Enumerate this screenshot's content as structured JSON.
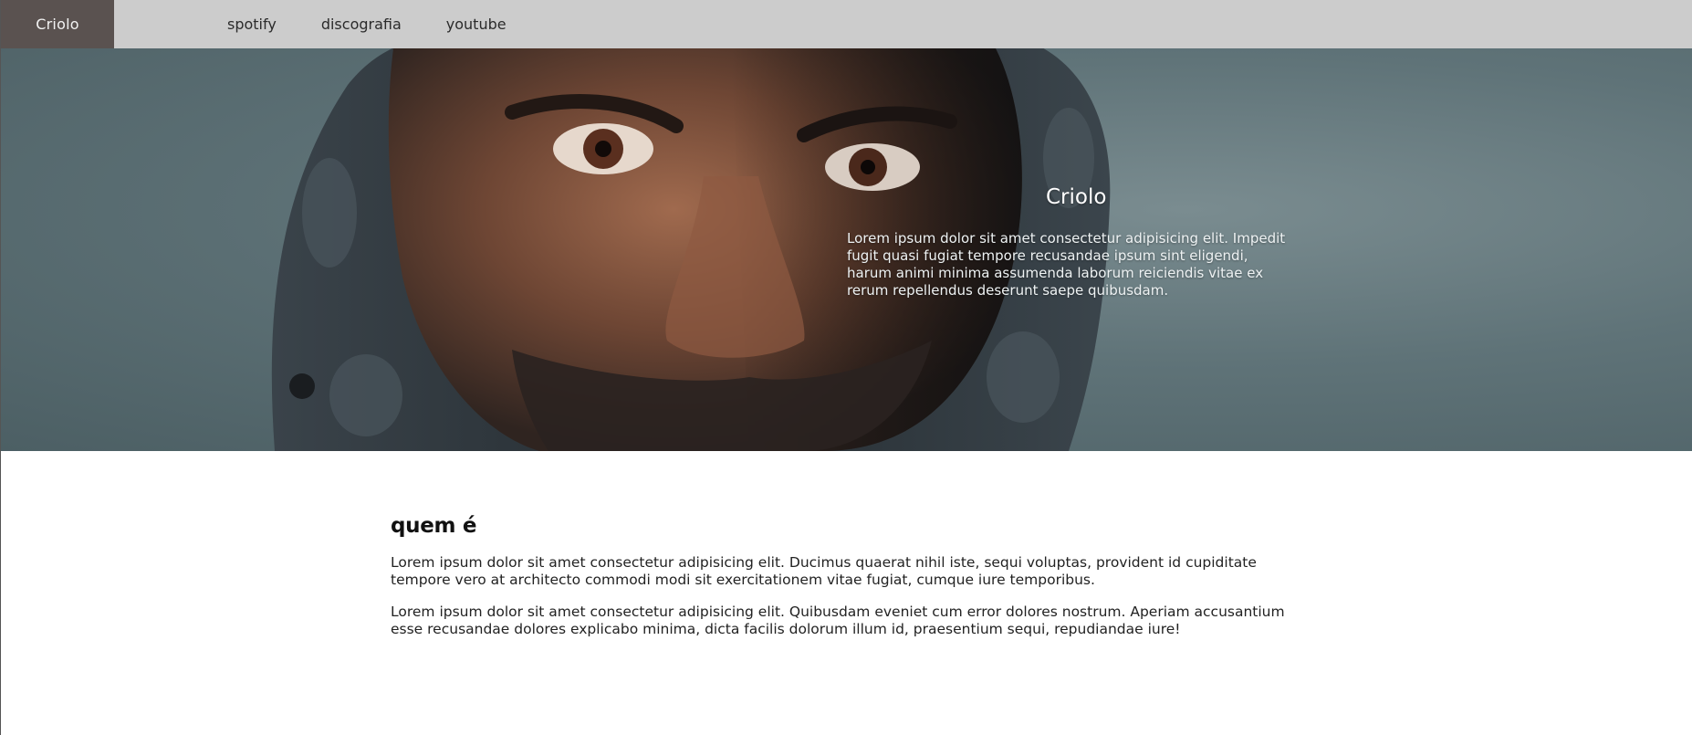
{
  "nav": {
    "brand": "Criolo",
    "links": [
      "spotify",
      "discografia",
      "youtube"
    ]
  },
  "hero": {
    "title": "Criolo",
    "text": "Lorem ipsum dolor sit amet consectetur adipisicing elit. Impedit fugit quasi fugiat tempore recusandae ipsum sint eligendi, harum animi minima assumenda laborum reiciendis vitae ex rerum repellendus deserunt saepe quibusdam."
  },
  "about": {
    "title": "quem é",
    "paragraphs": [
      "Lorem ipsum dolor sit amet consectetur adipisicing elit. Ducimus quaerat nihil iste, sequi voluptas, provident id cupiditate tempore vero at architecto commodi modi sit exercitationem vitae fugiat, cumque iure temporibus.",
      "Lorem ipsum dolor sit amet consectetur adipisicing elit. Quibusdam eveniet cum error dolores nostrum. Aperiam accusantium esse recusandae dolores explicabo minima, dicta facilis dolorum illum id, praesentium sequi, repudiandae iure!"
    ]
  },
  "colors": {
    "navbar_bg": "#cccccc",
    "brand_bg": "#5a5250",
    "hero_bg": "#5f7378"
  }
}
